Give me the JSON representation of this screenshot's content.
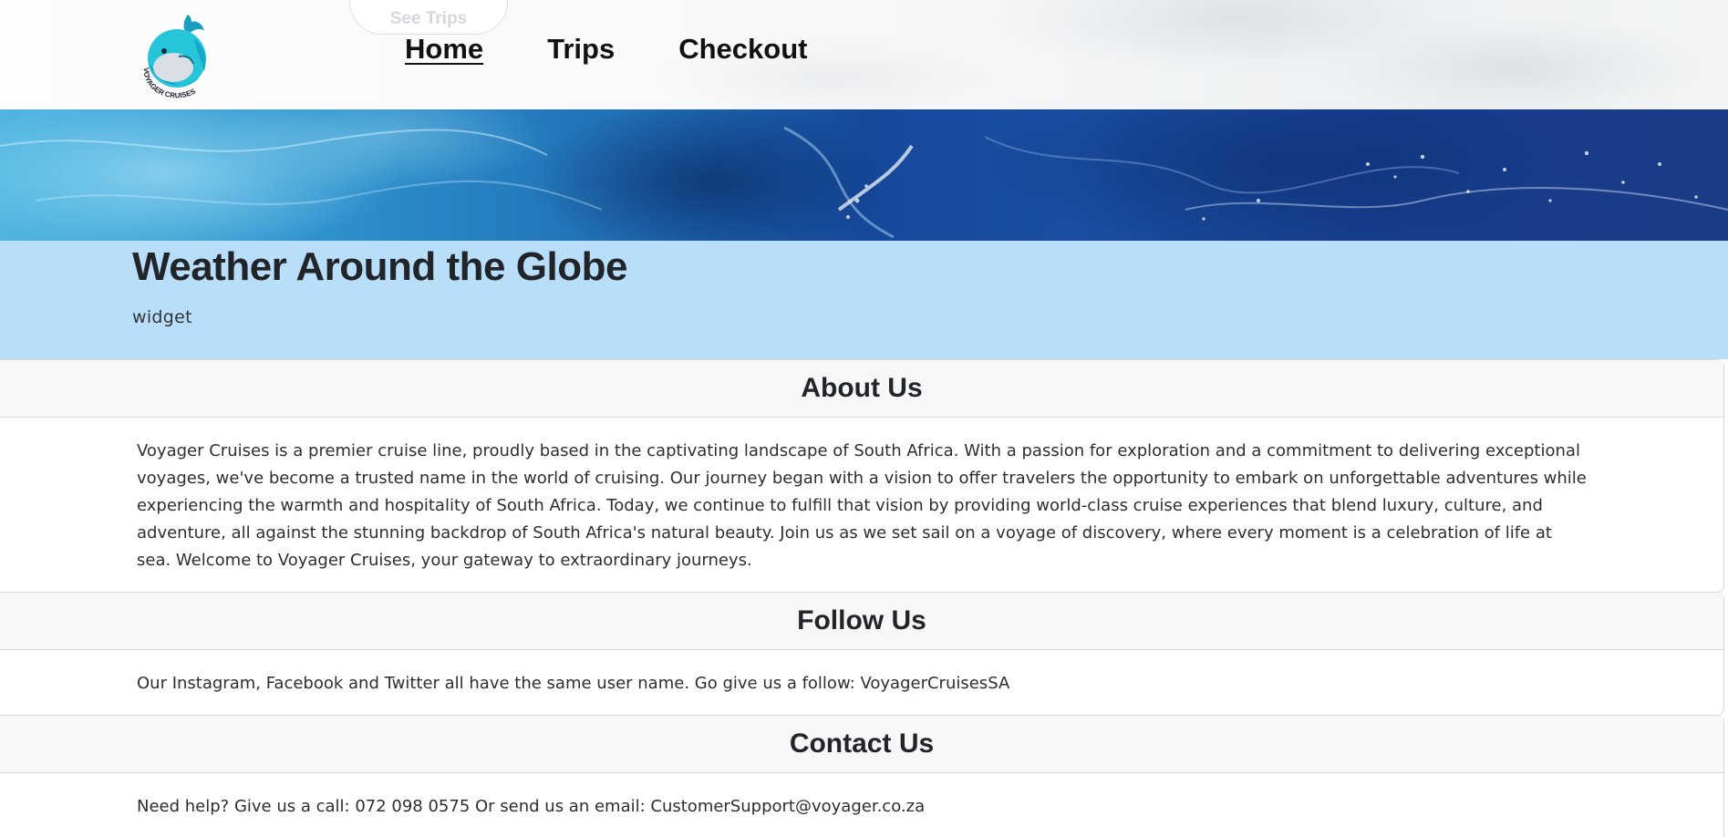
{
  "header": {
    "see_trips_label": "See Trips",
    "logo_alt": "Voyager Cruises logo",
    "logo_text": "VOYAGER CRUISES",
    "nav": [
      {
        "label": "Home",
        "active": true
      },
      {
        "label": "Trips",
        "active": false
      },
      {
        "label": "Checkout",
        "active": false
      }
    ]
  },
  "weather": {
    "title": "Weather Around the Globe",
    "widget_text": "widget",
    "bg_color": "#b8defa"
  },
  "sections": {
    "about": {
      "title": "About Us",
      "body": "Voyager Cruises is a premier cruise line, proudly based in the captivating landscape of South Africa. With a passion for exploration and a commitment to delivering exceptional voyages, we've become a trusted name in the world of cruising. Our journey began with a vision to offer travelers the opportunity to embark on unforgettable adventures while experiencing the warmth and hospitality of South Africa. Today, we continue to fulfill that vision by providing world-class cruise experiences that blend luxury, culture, and adventure, all against the stunning backdrop of South Africa's natural beauty. Join us as we set sail on a voyage of discovery, where every moment is a celebration of life at sea. Welcome to Voyager Cruises, your gateway to extraordinary journeys."
    },
    "follow": {
      "title": "Follow Us",
      "body": "Our Instagram, Facebook and Twitter all have the same user name. Go give us a follow: VoyagerCruisesSA"
    },
    "contact": {
      "title": "Contact Us",
      "body": "Need help? Give us a call: 072 098 0575 Or send us an email: CustomerSupport@voyager.co.za"
    }
  },
  "colors": {
    "accent": "#1fb3d6",
    "ocean_dark": "#16489a",
    "card_header_bg": "#f7f7f7"
  }
}
